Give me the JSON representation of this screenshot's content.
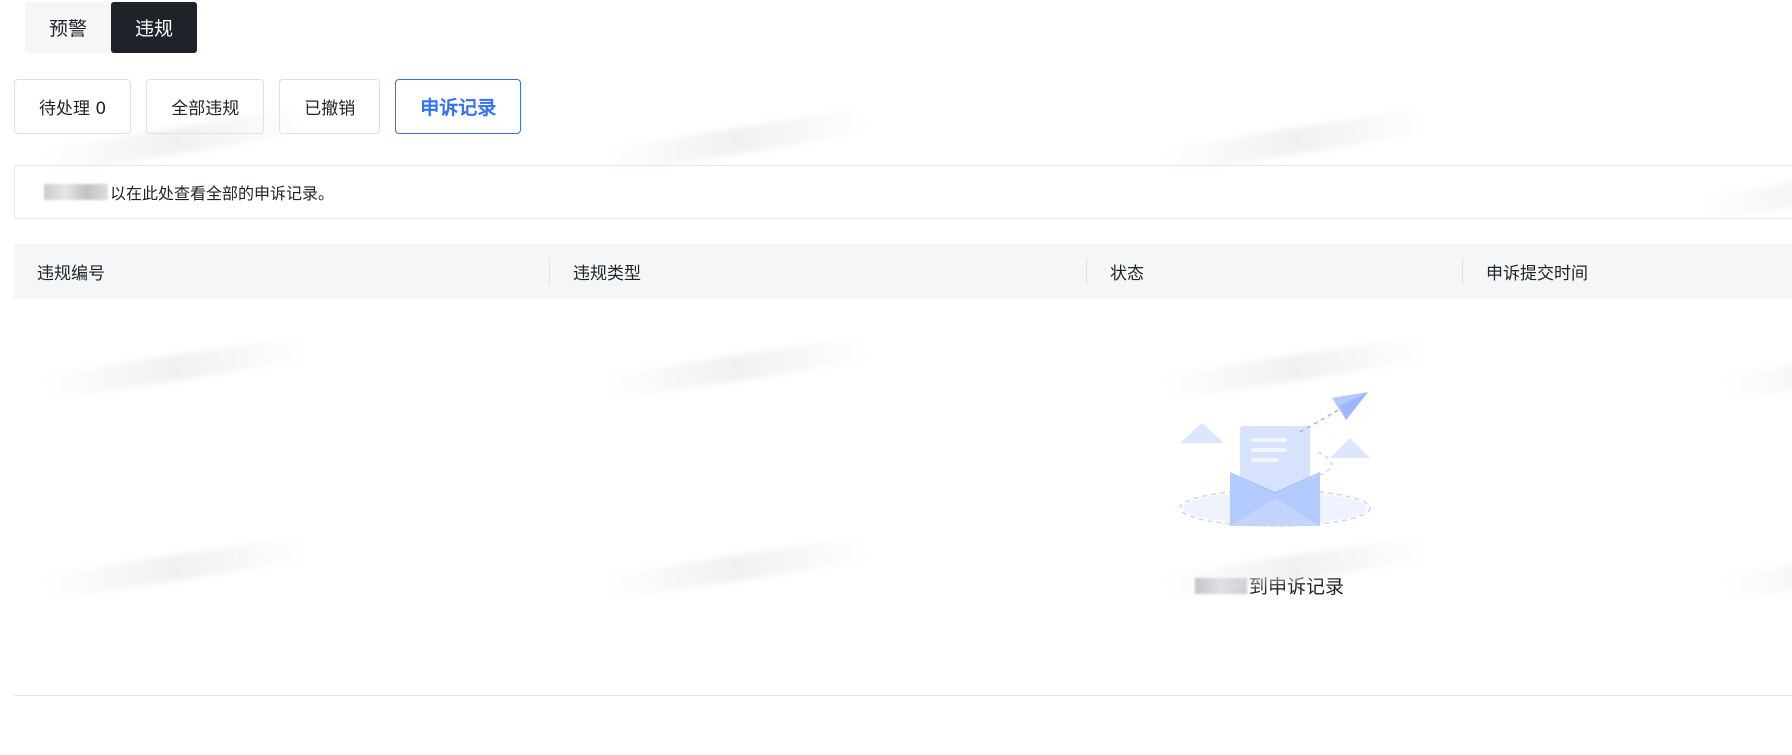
{
  "mode_switch": {
    "items": [
      {
        "label": "预警",
        "active": false
      },
      {
        "label": "违规",
        "active": true
      }
    ]
  },
  "filter_tabs": [
    {
      "label": "待处理 0",
      "active": false
    },
    {
      "label": "全部违规",
      "active": false
    },
    {
      "label": "已撤销",
      "active": false
    },
    {
      "label": "申诉记录",
      "active": true
    }
  ],
  "info_bar": {
    "text": "以在此处查看全部的申诉记录。"
  },
  "table": {
    "columns": [
      "违规编号",
      "违规类型",
      "状态",
      "申诉提交时间"
    ],
    "rows": []
  },
  "empty_state": {
    "text": "到申诉记录",
    "icon": "envelope-paper-plane-icon"
  },
  "colors": {
    "accent": "#3370ff",
    "active_segment": "#1f2329",
    "header_bg": "#f5f6f7",
    "border": "#dee0e3"
  }
}
